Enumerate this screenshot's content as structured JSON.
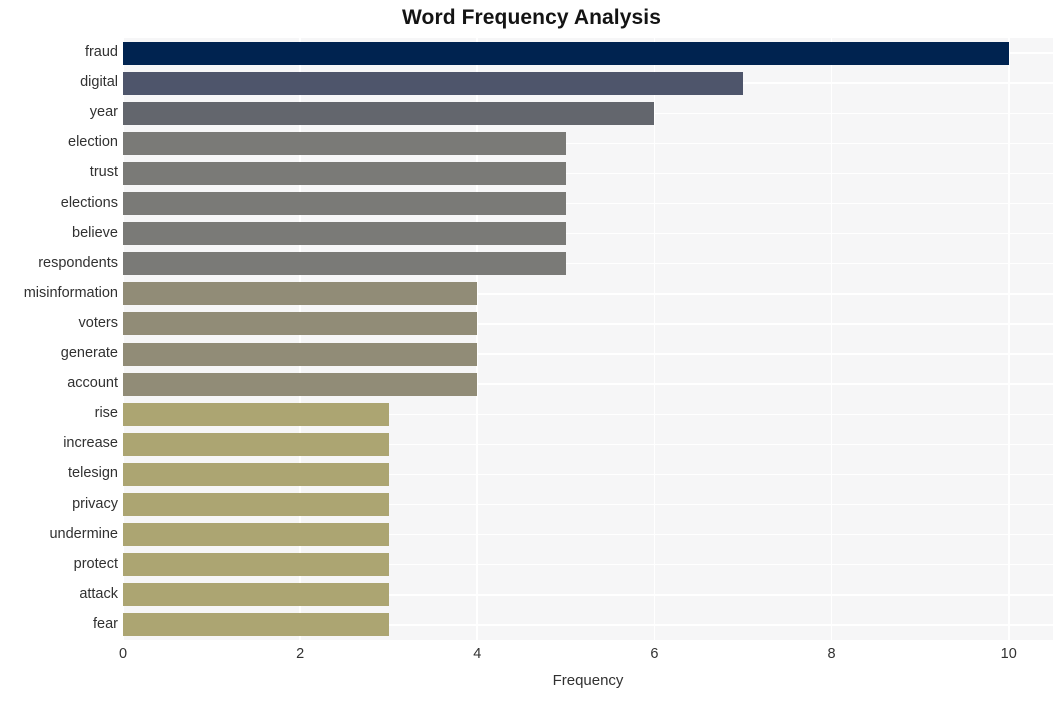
{
  "chart_data": {
    "type": "bar",
    "orientation": "horizontal",
    "title": "Word Frequency Analysis",
    "xlabel": "Frequency",
    "ylabel": "",
    "xlim": [
      0,
      10.5
    ],
    "xticks": [
      0,
      2,
      4,
      6,
      8,
      10
    ],
    "grid": true,
    "legend": null,
    "categories": [
      "fraud",
      "digital",
      "year",
      "election",
      "trust",
      "elections",
      "believe",
      "respondents",
      "misinformation",
      "voters",
      "generate",
      "account",
      "rise",
      "increase",
      "telesign",
      "privacy",
      "undermine",
      "protect",
      "attack",
      "fear"
    ],
    "values": [
      10,
      7,
      6,
      5,
      5,
      5,
      5,
      5,
      4,
      4,
      4,
      4,
      3,
      3,
      3,
      3,
      3,
      3,
      3,
      3
    ],
    "bar_colors": [
      "#002350",
      "#4e556b",
      "#63666d",
      "#7a7a77",
      "#7a7a77",
      "#7a7a77",
      "#7a7a77",
      "#7a7a77",
      "#918c77",
      "#918c77",
      "#918c77",
      "#918c77",
      "#aca572",
      "#aca572",
      "#aca572",
      "#aca572",
      "#aca572",
      "#aca572",
      "#aca572",
      "#aca572"
    ]
  },
  "style": {
    "plot_background": "#f6f6f7",
    "figure_background": "#ffffff",
    "grid_color": "#ffffff",
    "text_color": "#313131",
    "title_color": "#141414"
  }
}
